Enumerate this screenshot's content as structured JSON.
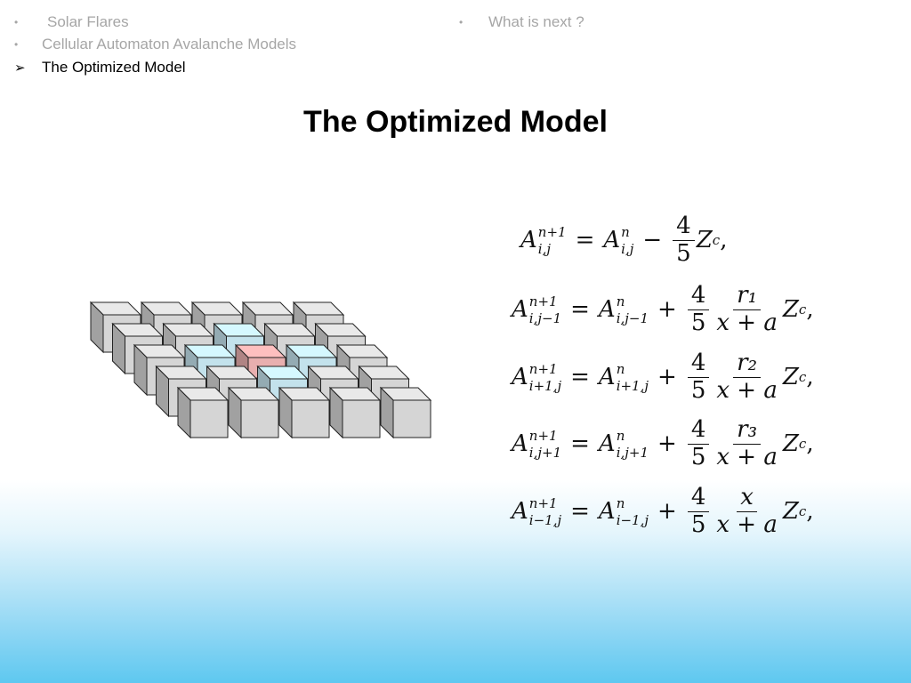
{
  "nav": {
    "items": [
      {
        "label": "Solar Flares",
        "marker": "•",
        "active": false
      },
      {
        "label": "Cellular Automaton Avalanche Models",
        "marker": "•",
        "active": false
      },
      {
        "label": "The Optimized Model",
        "marker": "➢",
        "active": true
      },
      {
        "label": "What is next ?",
        "marker": "•",
        "active": false
      }
    ]
  },
  "slide": {
    "title": "The Optimized Model"
  },
  "figure": {
    "description": "5x5 grid of cubes; center cube highlighted red, four neighbors highlighted blue",
    "rows": 5,
    "cols": 5,
    "center_color": "#f4b8b8",
    "neighbor_color": "#cdeef8",
    "default_color": "#e0e0e0"
  },
  "equations": [
    {
      "lhs_base": "A",
      "lhs_sup": "n+1",
      "lhs_sub": "i,j",
      "rhs_base": "A",
      "rhs_sup": "n",
      "rhs_sub": "i,j",
      "op": "−",
      "coef_num": "4",
      "coef_den": "5",
      "ratio_num": "",
      "ratio_den": "",
      "tail": "Z",
      "tail_sub": "c",
      "end": ","
    },
    {
      "lhs_base": "A",
      "lhs_sup": "n+1",
      "lhs_sub": "i,j−1",
      "rhs_base": "A",
      "rhs_sup": "n",
      "rhs_sub": "i,j−1",
      "op": "+",
      "coef_num": "4",
      "coef_den": "5",
      "ratio_num": "r₁",
      "ratio_den": "x + a",
      "tail": "Z",
      "tail_sub": "c",
      "end": ","
    },
    {
      "lhs_base": "A",
      "lhs_sup": "n+1",
      "lhs_sub": "i+1,j",
      "rhs_base": "A",
      "rhs_sup": "n",
      "rhs_sub": "i+1,j",
      "op": "+",
      "coef_num": "4",
      "coef_den": "5",
      "ratio_num": "r₂",
      "ratio_den": "x + a",
      "tail": "Z",
      "tail_sub": "c",
      "end": ","
    },
    {
      "lhs_base": "A",
      "lhs_sup": "n+1",
      "lhs_sub": "i,j+1",
      "rhs_base": "A",
      "rhs_sup": "n",
      "rhs_sub": "i,j+1",
      "op": "+",
      "coef_num": "4",
      "coef_den": "5",
      "ratio_num": "r₃",
      "ratio_den": "x + a",
      "tail": "Z",
      "tail_sub": "c",
      "end": ","
    },
    {
      "lhs_base": "A",
      "lhs_sup": "n+1",
      "lhs_sub": "i−1,j",
      "rhs_base": "A",
      "rhs_sup": "n",
      "rhs_sub": "i−1,j",
      "op": "+",
      "coef_num": "4",
      "coef_den": "5",
      "ratio_num": "x",
      "ratio_den": "x + a",
      "tail": "Z",
      "tail_sub": "c",
      "end": ","
    }
  ]
}
